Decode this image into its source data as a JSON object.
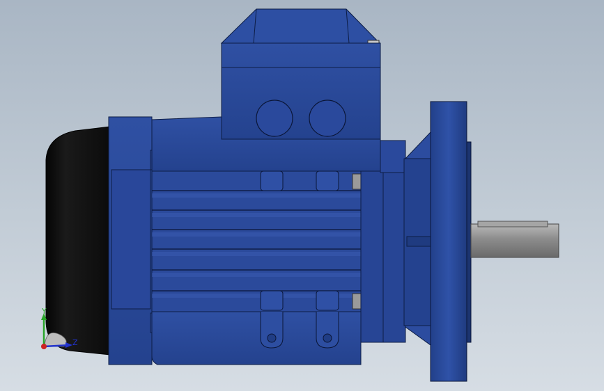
{
  "viewport": {
    "background_top": "#a9b6c4",
    "background_bottom": "#d6dde4"
  },
  "motor": {
    "body_color": "#2b4a97",
    "shade_color": "#1d3575",
    "highlight_color": "#3b5cb0",
    "fan_cover_color": "#111111",
    "shaft_color": "#8e8e8e"
  },
  "triad": {
    "y_label": "Y",
    "z_label": "Z",
    "y_color": "#2aa52a",
    "z_color": "#2233cc",
    "x_color": "#cc2222"
  }
}
